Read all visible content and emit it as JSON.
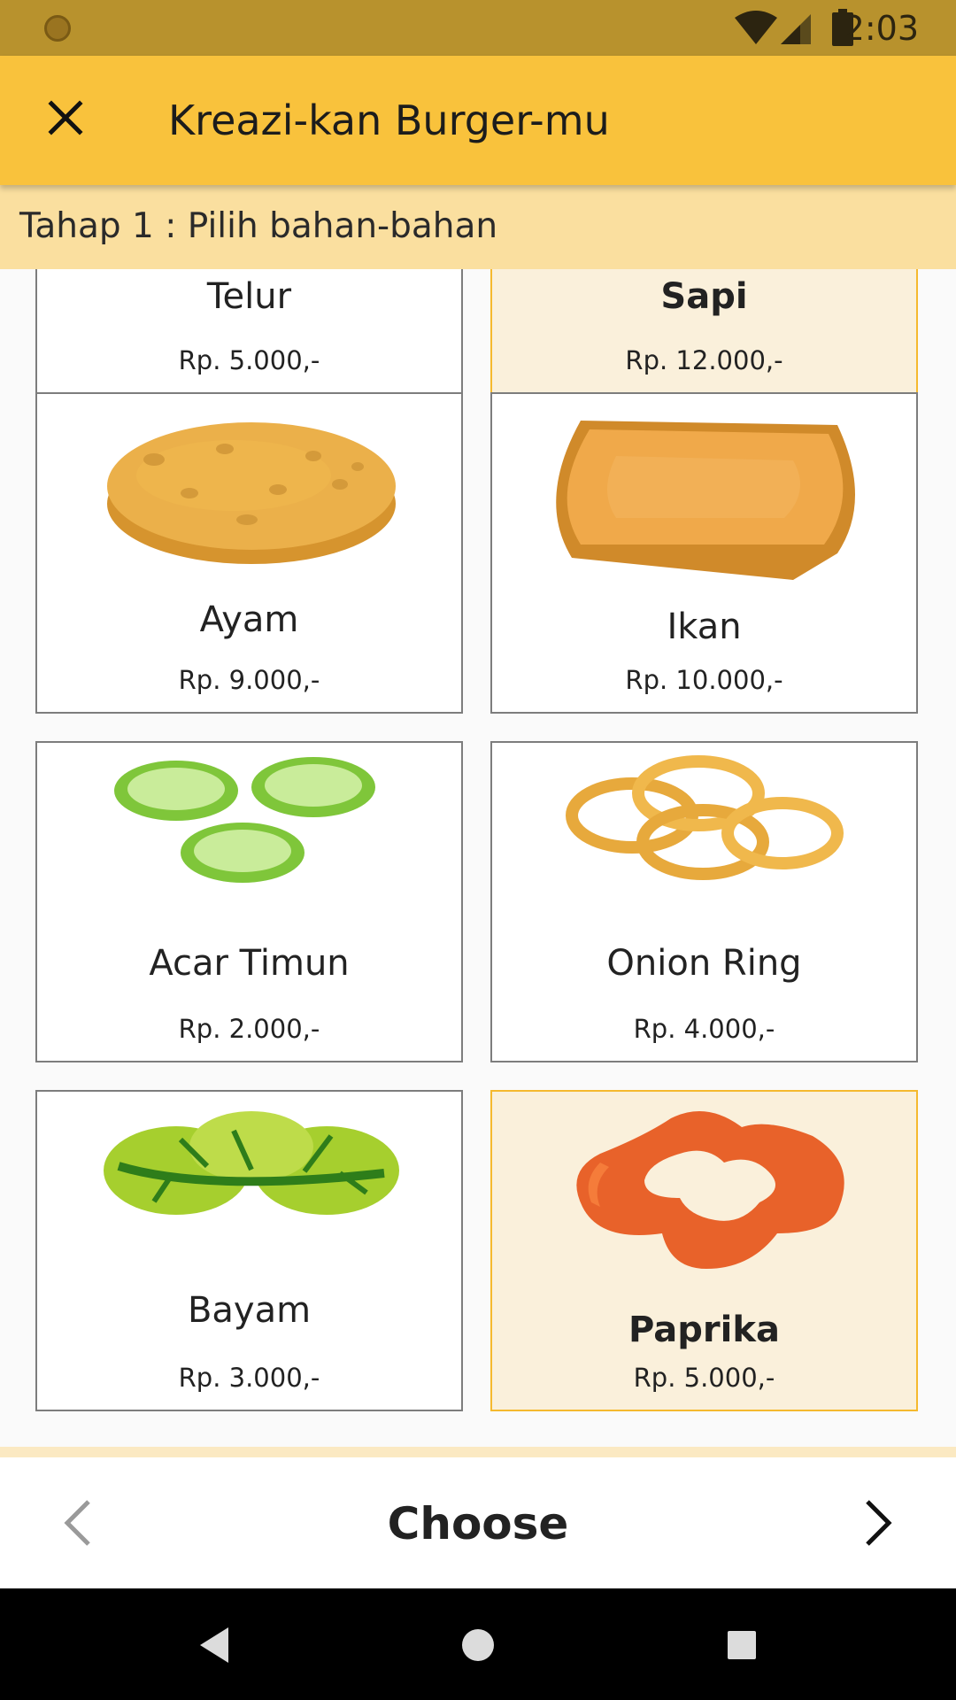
{
  "status_bar": {
    "time": "2:03"
  },
  "app_bar": {
    "title": "Kreazi-kan Burger-mu"
  },
  "step": {
    "text": "Tahap 1 : Pilih bahan-bahan"
  },
  "ingredients": [
    {
      "name": "Telur",
      "price": "Rp. 5.000,-",
      "selected": false,
      "icon": "egg-icon"
    },
    {
      "name": "Sapi",
      "price": "Rp. 12.000,-",
      "selected": true,
      "icon": "beef-patty-icon"
    },
    {
      "name": "Ayam",
      "price": "Rp. 9.000,-",
      "selected": false,
      "icon": "chicken-patty-icon"
    },
    {
      "name": "Ikan",
      "price": "Rp. 10.000,-",
      "selected": false,
      "icon": "fish-fillet-icon"
    },
    {
      "name": "Acar Timun",
      "price": "Rp. 2.000,-",
      "selected": false,
      "icon": "pickle-icon"
    },
    {
      "name": "Onion Ring",
      "price": "Rp. 4.000,-",
      "selected": false,
      "icon": "onion-ring-icon"
    },
    {
      "name": "Bayam",
      "price": "Rp. 3.000,-",
      "selected": false,
      "icon": "spinach-icon"
    },
    {
      "name": "Paprika",
      "price": "Rp. 5.000,-",
      "selected": true,
      "icon": "paprika-icon"
    }
  ],
  "bottom_bar": {
    "choose_label": "Choose"
  },
  "colors": {
    "app_bar": "#f9c23c",
    "status_bar": "#b8922d",
    "step_bar": "#fadf9f",
    "selected_card": "#faf0db",
    "selected_border": "#f5b92e"
  }
}
